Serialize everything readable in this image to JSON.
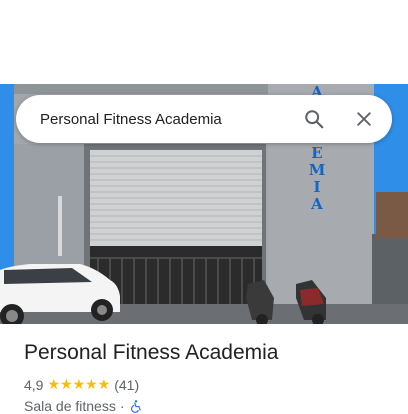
{
  "search": {
    "query": "Personal Fitness Academia"
  },
  "place": {
    "name": "Personal Fitness Academia",
    "rating": "4,9",
    "stars": "★★★★★",
    "review_count": "(41)",
    "category": "Sala de fitness",
    "separator": "·"
  },
  "photo": {
    "sign_letters": [
      "A",
      "E",
      "M",
      "I",
      "A"
    ]
  },
  "colors": {
    "sky": "#1e88e5",
    "wall": "#9ea3a8",
    "shutter": "#c8cacb",
    "sign_text": "#1565c0",
    "star": "#fbbc04"
  }
}
